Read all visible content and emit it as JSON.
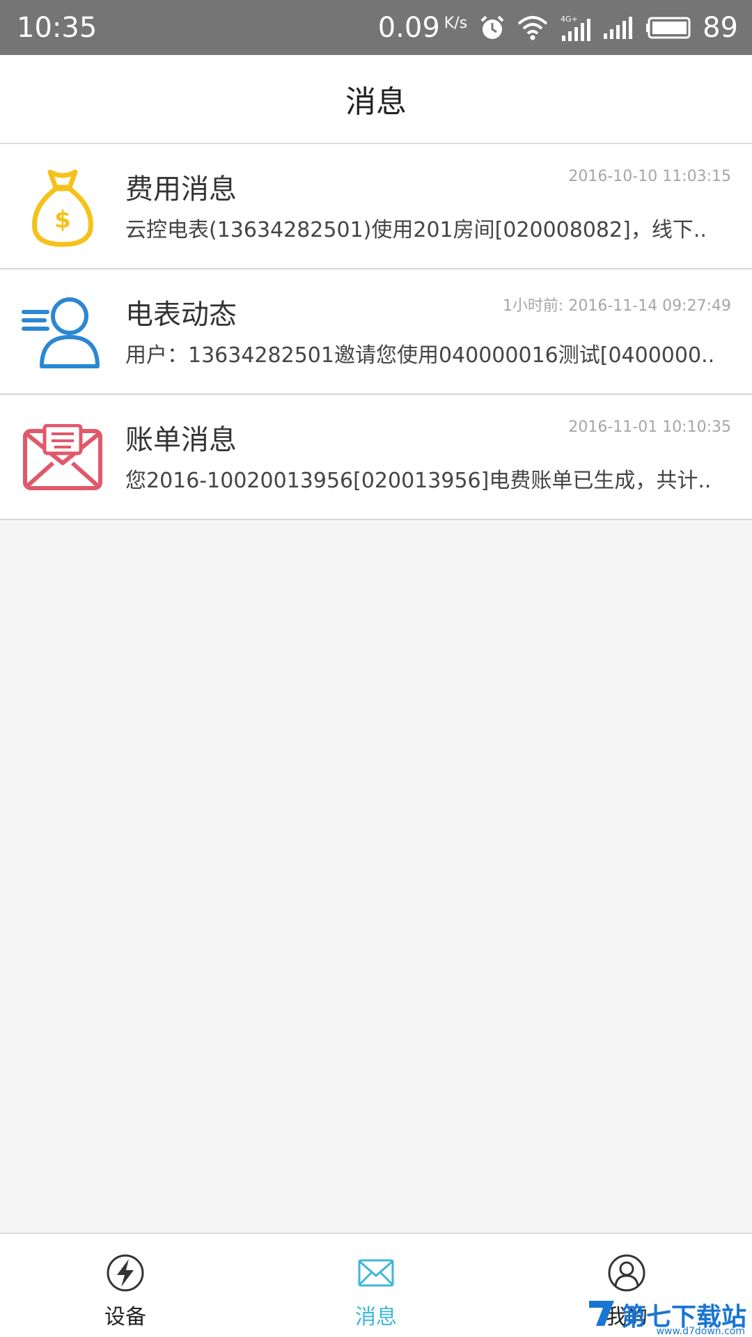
{
  "status_bar": {
    "time": "10:35",
    "speed": "0.09",
    "speed_unit": "K/s",
    "battery": "89"
  },
  "header": {
    "title": "消息"
  },
  "messages": [
    {
      "title": "费用消息",
      "time": "2016-10-10 11:03:15",
      "body": "云控电表(13634282501)使用201房间[020008082]，线下..",
      "icon": "money-bag-icon",
      "icon_color": "#f5c21b"
    },
    {
      "title": "电表动态",
      "time": "1小时前: 2016-11-14 09:27:49",
      "body": "用户：13634282501邀请您使用040000016测试[0400000..",
      "icon": "user-speed-icon",
      "icon_color": "#2b87d3"
    },
    {
      "title": "账单消息",
      "time": "2016-11-01 10:10:35",
      "body": "您2016-10020013956[020013956]电费账单已生成，共计..",
      "icon": "envelope-icon",
      "icon_color": "#e0596b"
    }
  ],
  "tabs": [
    {
      "label": "设备",
      "icon": "lightning-icon",
      "active": false
    },
    {
      "label": "消息",
      "icon": "mail-icon",
      "active": true
    },
    {
      "label": "我的",
      "icon": "person-icon",
      "active": false
    }
  ],
  "colors": {
    "active_tab": "#3fb6d8",
    "inactive_tab": "#222222"
  },
  "watermark": {
    "text": "第七下载站",
    "sub": "www.d7down.com"
  }
}
